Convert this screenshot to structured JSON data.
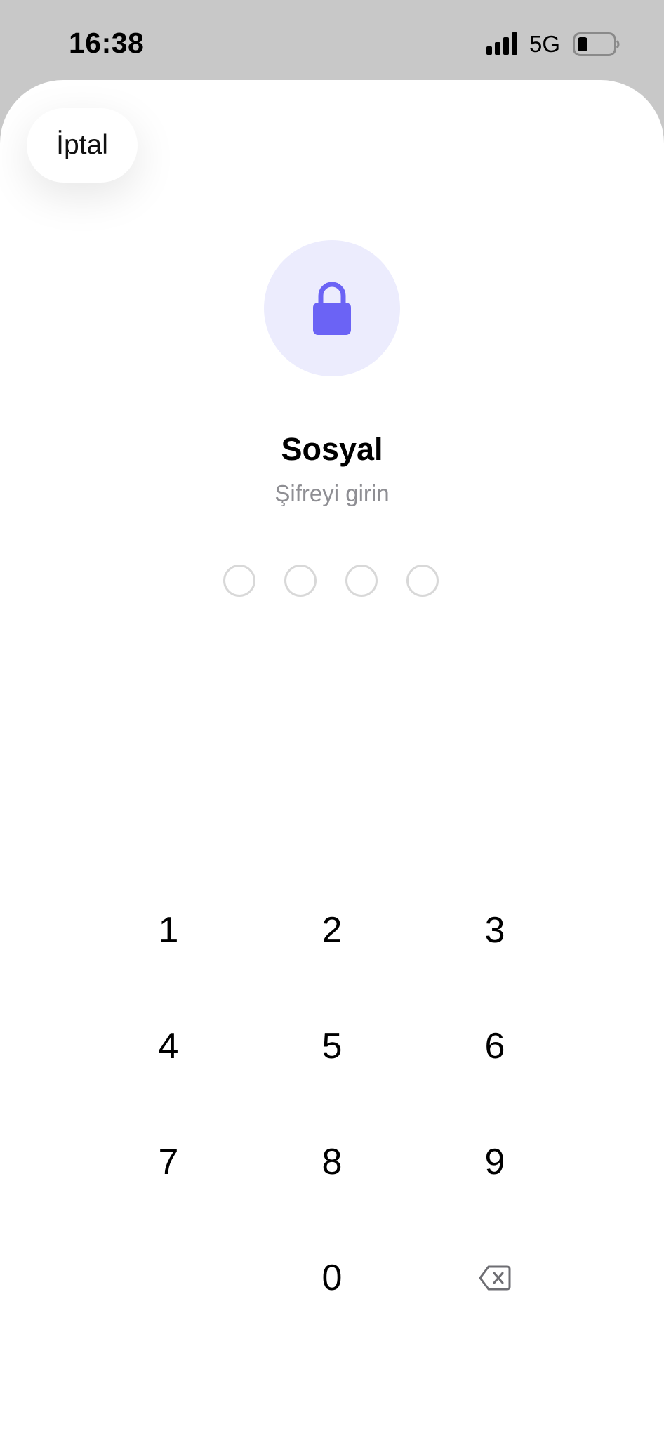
{
  "status_bar": {
    "time": "16:38",
    "network": "5G",
    "signal_icon": "cellular-signal-icon",
    "battery_icon": "battery-low-icon"
  },
  "sheet": {
    "cancel_label": "İptal",
    "lock_icon": "lock-icon",
    "title": "Sosyal",
    "subtitle": "Şifreyi girin",
    "pin_length": 4,
    "pin_filled": 0
  },
  "keypad": {
    "keys": [
      "1",
      "2",
      "3",
      "4",
      "5",
      "6",
      "7",
      "8",
      "9",
      "0"
    ],
    "delete_icon": "backspace-icon"
  },
  "colors": {
    "accent": "#6b63f5",
    "accent_light": "#ececfd",
    "background": "#c8c8c8",
    "sheet": "#ffffff",
    "subtitle": "#8e8e93",
    "dot_border": "#d8d8d8"
  }
}
